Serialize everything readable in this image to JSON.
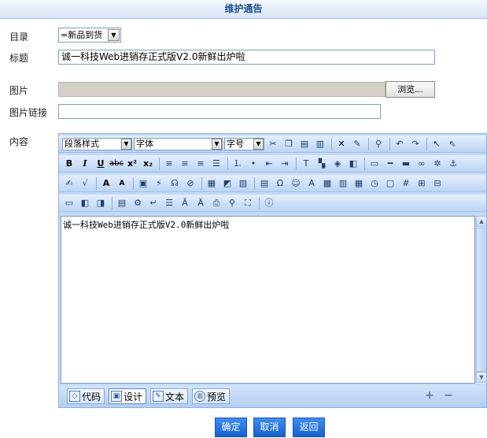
{
  "header": {
    "title": "维护通告"
  },
  "form": {
    "category_label": "目录",
    "category_value": "=新品到货",
    "title_label": "标题",
    "title_value": "诚一科技Web进销存正式版V2.0新鲜出炉啦",
    "image_label": "图片",
    "browse_label": "浏览...",
    "image_link_label": "图片链接",
    "image_link_value": "",
    "content_label": "内容"
  },
  "editor": {
    "paragraph_style": "段落样式",
    "font_family": "字体",
    "font_size": "字号",
    "content_text": "诚一科技Web进销存正式版V2.0新鲜出炉啦",
    "modes": [
      "代码",
      "设计",
      "文本",
      "预览"
    ],
    "active_mode": "设计",
    "zoom_in": "+",
    "zoom_out": "−"
  },
  "buttons": {
    "confirm": "确定",
    "cancel": "取消",
    "back": "返回"
  },
  "colors": {
    "accent": "#1560d0",
    "header_text": "#1e4f8d",
    "toolbar_bg": "#c3daf5"
  }
}
